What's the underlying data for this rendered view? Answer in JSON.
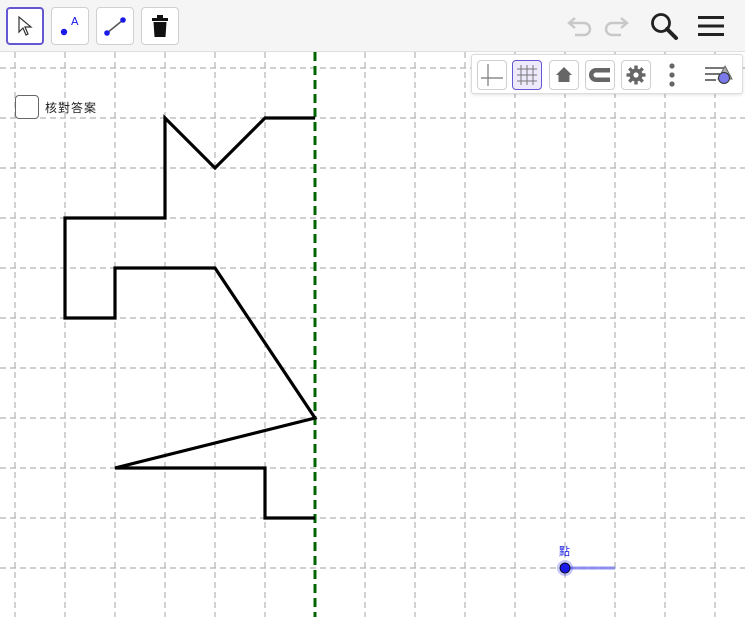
{
  "toolbar": {
    "tools": [
      {
        "name": "move-tool",
        "icon": "cursor-arrow-icon",
        "selected": true
      },
      {
        "name": "point-tool",
        "icon": "point-a-icon",
        "selected": false,
        "glyph": "A"
      },
      {
        "name": "segment-tool",
        "icon": "segment-icon",
        "selected": false
      },
      {
        "name": "delete-tool",
        "icon": "trash-icon",
        "selected": false
      }
    ],
    "right_icons": [
      "undo-icon",
      "redo-icon",
      "search-icon",
      "menu-icon"
    ]
  },
  "style_bar": {
    "buttons": [
      {
        "name": "axes-toggle",
        "icon": "axes-icon",
        "active": false
      },
      {
        "name": "grid-toggle",
        "icon": "grid-icon",
        "active": true
      },
      {
        "name": "standard-view",
        "icon": "home-icon",
        "active": false
      },
      {
        "name": "point-capturing",
        "icon": "magnet-icon",
        "active": false
      },
      {
        "name": "graphics-settings",
        "icon": "gear-icon",
        "active": false
      },
      {
        "name": "more-options",
        "icon": "vertical-dots-icon",
        "active": false
      },
      {
        "name": "algebra-view-toggle",
        "icon": "algebra-shapes-icon",
        "active": false
      }
    ]
  },
  "checkbox": {
    "label": "核對答案",
    "checked": false
  },
  "point": {
    "label": "點"
  },
  "colors": {
    "accent": "#6557d2",
    "mirror_line": "#006400",
    "shape": "#000000",
    "grid": "#b4b4b4",
    "point": "#1a1ae6",
    "slider": "#8080ee"
  }
}
